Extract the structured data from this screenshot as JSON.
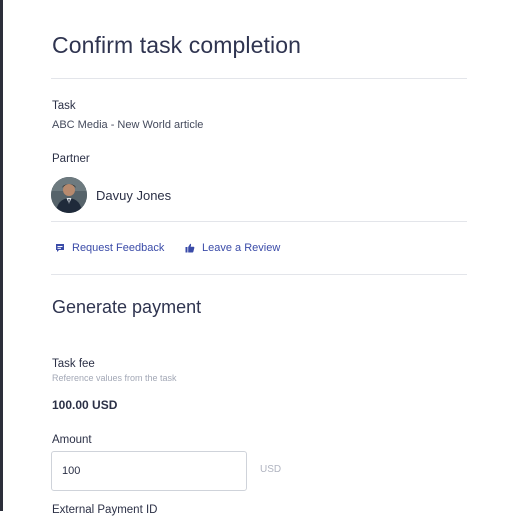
{
  "dialog": {
    "title": "Confirm task completion"
  },
  "task": {
    "label": "Task",
    "value": "ABC Media - New World article"
  },
  "partner": {
    "label": "Partner",
    "name": "Davuy Jones"
  },
  "actions": {
    "request_feedback": {
      "label": "Request Feedback",
      "icon": "speech-bubble-icon"
    },
    "leave_review": {
      "label": "Leave a Review",
      "icon": "thumbs-up-icon"
    }
  },
  "payment": {
    "section_title": "Generate payment",
    "task_fee_label": "Task fee",
    "task_fee_hint": "Reference values from the task",
    "task_fee_value": "100.00 USD",
    "amount_label": "Amount",
    "amount_value": "100",
    "currency": "USD",
    "next_label_partial": "External Payment ID"
  },
  "colors": {
    "link": "#3a4ba8",
    "heading": "#2f3450",
    "divider": "#e3e5ea"
  }
}
